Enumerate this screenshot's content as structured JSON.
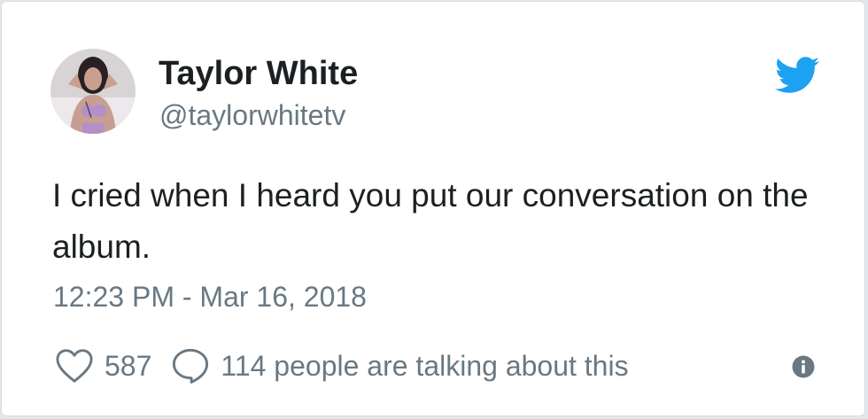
{
  "tweet": {
    "author_name": "Taylor White",
    "author_handle": "@taylorwhitetv",
    "text": "I cried when I heard you put our conversation on the album.",
    "timestamp": "12:23 PM - Mar 16, 2018",
    "likes": "587",
    "conversation": "114 people are talking about this"
  },
  "icons": {
    "brand": "twitter-bird-icon",
    "like": "heart-icon",
    "reply": "speech-bubble-icon",
    "info": "info-icon"
  },
  "colors": {
    "twitter_blue": "#1da1f2",
    "text": "#1c2022",
    "secondary_text": "#697882"
  }
}
